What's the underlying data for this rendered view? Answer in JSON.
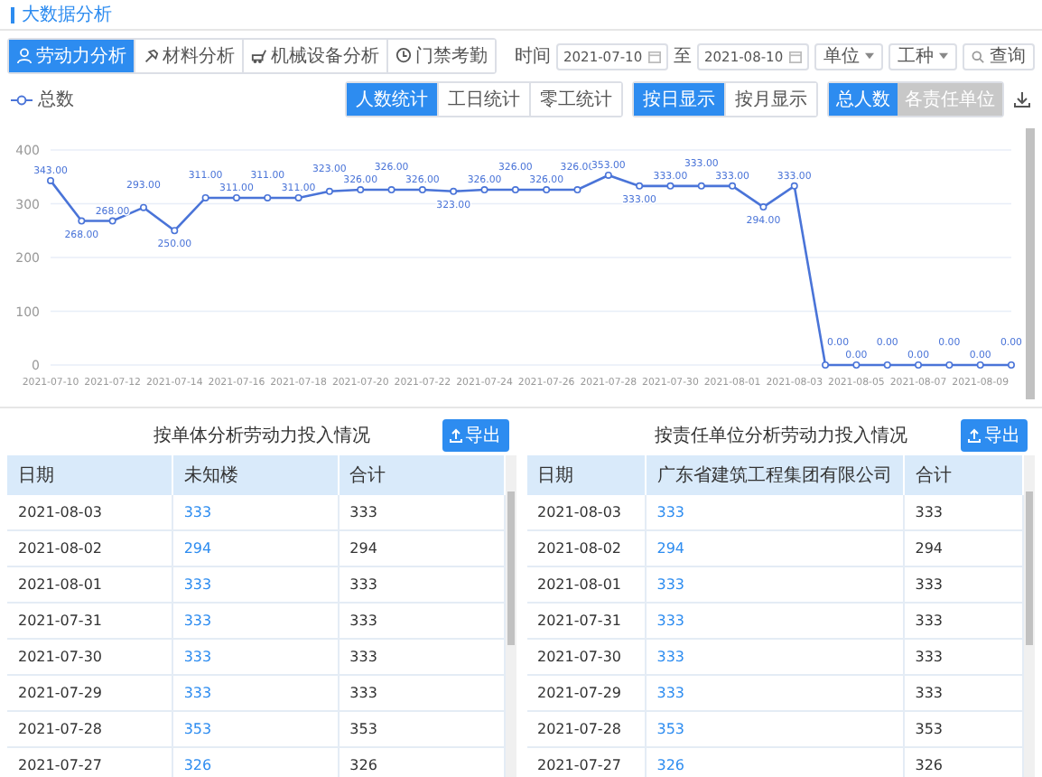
{
  "header": {
    "title": "大数据分析"
  },
  "tabs": [
    {
      "label": "劳动力分析",
      "selected": true
    },
    {
      "label": "材料分析",
      "selected": false
    },
    {
      "label": "机械设备分析",
      "selected": false
    },
    {
      "label": "门禁考勤",
      "selected": false
    }
  ],
  "filters": {
    "time_label": "时间",
    "start_date": "2021-07-10",
    "to_label": "至",
    "end_date": "2021-08-10",
    "unit_select": "单位",
    "trade_select": "工种",
    "search_button": "查询"
  },
  "stat_modes": [
    {
      "label": "人数统计",
      "selected": true
    },
    {
      "label": "工日统计",
      "selected": false
    },
    {
      "label": "零工统计",
      "selected": false
    }
  ],
  "display_modes": [
    {
      "label": "按日显示",
      "selected": true
    },
    {
      "label": "按月显示",
      "selected": false
    }
  ],
  "series_modes": [
    {
      "label": "总人数",
      "selected": true
    },
    {
      "label": "各责任单位",
      "selected": false
    }
  ],
  "chart_data": {
    "type": "line",
    "ylim": [
      0,
      400
    ],
    "yticks": [
      0,
      100,
      200,
      300,
      400
    ],
    "grid": true,
    "categories": [
      "2021-07-10",
      null,
      "2021-07-12",
      null,
      "2021-07-14",
      null,
      "2021-07-16",
      null,
      "2021-07-18",
      null,
      "2021-07-20",
      null,
      "2021-07-22",
      null,
      "2021-07-24",
      null,
      "2021-07-26",
      null,
      "2021-07-28",
      null,
      "2021-07-30",
      null,
      "2021-08-01",
      null,
      "2021-08-03",
      null,
      "2021-08-05",
      null,
      "2021-08-07",
      null,
      "2021-08-09",
      null
    ],
    "series": [
      {
        "name": "总数",
        "color": "#4a74d8",
        "marker": "circle",
        "values": [
          343,
          268,
          268,
          293,
          250,
          311,
          311,
          311,
          311,
          323,
          326,
          326,
          326,
          323,
          326,
          326,
          326,
          326,
          353,
          333,
          333,
          333,
          333,
          294,
          333,
          0,
          0,
          0,
          0,
          0,
          0,
          0
        ],
        "value_labels": [
          "343.00",
          "268.00",
          "268.00",
          "293.00",
          "250.00",
          "311.00",
          "311.00",
          "311.00",
          "311.00",
          "323.00",
          "326.00",
          "326.00",
          "326.00",
          "323.00",
          "326.00",
          "326.00",
          "326.00",
          "326.00",
          "353.00",
          "333.00",
          "333.00",
          "333.00",
          "333.00",
          "294.00",
          "333.00",
          "0.00",
          "0.00",
          "0.00",
          "0.00",
          "0.00",
          "0.00",
          "0.00"
        ]
      }
    ]
  },
  "tables": [
    {
      "title": "按单体分析劳动力投入情况",
      "export_button": "导出",
      "columns": [
        "日期",
        "未知楼",
        "合计"
      ],
      "rows": [
        [
          "2021-08-03",
          "333",
          "333"
        ],
        [
          "2021-08-02",
          "294",
          "294"
        ],
        [
          "2021-08-01",
          "333",
          "333"
        ],
        [
          "2021-07-31",
          "333",
          "333"
        ],
        [
          "2021-07-30",
          "333",
          "333"
        ],
        [
          "2021-07-29",
          "333",
          "333"
        ],
        [
          "2021-07-28",
          "353",
          "353"
        ],
        [
          "2021-07-27",
          "326",
          "326"
        ]
      ]
    },
    {
      "title": "按责任单位分析劳动力投入情况",
      "export_button": "导出",
      "columns": [
        "日期",
        "广东省建筑工程集团有限公司",
        "合计"
      ],
      "rows": [
        [
          "2021-08-03",
          "333",
          "333"
        ],
        [
          "2021-08-02",
          "294",
          "294"
        ],
        [
          "2021-08-01",
          "333",
          "333"
        ],
        [
          "2021-07-31",
          "333",
          "333"
        ],
        [
          "2021-07-30",
          "333",
          "333"
        ],
        [
          "2021-07-29",
          "333",
          "333"
        ],
        [
          "2021-07-28",
          "353",
          "353"
        ],
        [
          "2021-07-27",
          "326",
          "326"
        ]
      ]
    }
  ]
}
